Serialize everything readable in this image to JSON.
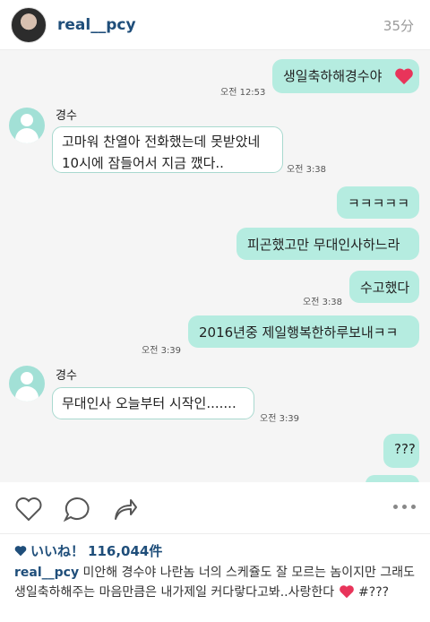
{
  "header": {
    "username": "real__pcy",
    "time_ago": "35分"
  },
  "chat": {
    "contact_name": "경수",
    "messages": [
      {
        "text": "생일축하해경수야",
        "time": "오전 12:53",
        "emoji": "heart"
      },
      {
        "line1": "고마워 찬열아 전화했는데 못받았네",
        "line2": "10시에 잠들어서 지금 깼다..",
        "time": "오전 3:38"
      },
      {
        "text": "ㅋㅋㅋㅋㅋ"
      },
      {
        "text": "피곤했고만 무대인사하느라"
      },
      {
        "text": "수고했다",
        "time": "오전 3:38"
      },
      {
        "text": "2016년중 제일행복한하루보내ㅋㅋ",
        "time": "오전 3:39"
      },
      {
        "text": "무대인사 오늘부터 시작인.......",
        "time": "오전 3:39"
      },
      {
        "text": "???"
      }
    ]
  },
  "likes": {
    "label": "いいね！",
    "count": "116,044件"
  },
  "caption": {
    "username": "real__pcy",
    "text": "미안해 경수야 나란놈 너의 스케쥴도 잘 모르는 놈이지만 그래도 생일축하해주는 마음만큼은 내가제일 커다랗다고봐..사랑한다",
    "suffix": "#???"
  },
  "colors": {
    "accent": "#1f4e7a",
    "bubble_out": "#b5ece0",
    "heart": "#e8345a"
  }
}
